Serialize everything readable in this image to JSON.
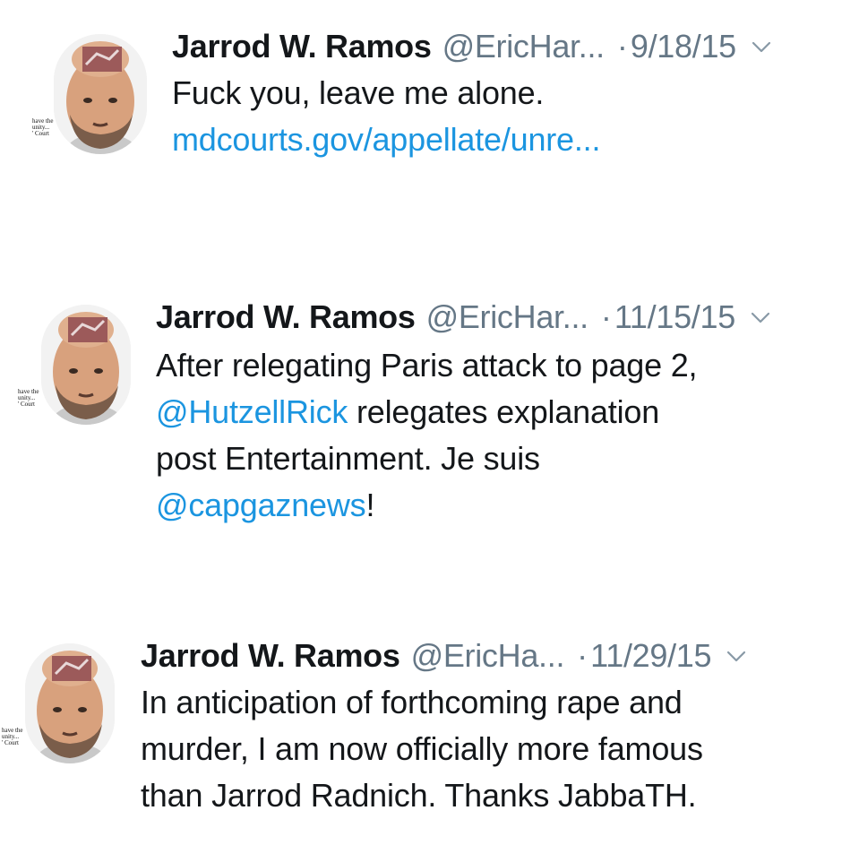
{
  "tweets": [
    {
      "name": "Jarrod W. Ramos",
      "handle": "@EricHar...",
      "dot": "·",
      "date": "9/18/15",
      "avatar_caption": "have the\nunity...\n' Court",
      "lines": [
        [
          {
            "text": "Fuck you, leave me alone.",
            "type": "text"
          }
        ],
        [
          {
            "text": "mdcourts.gov/appellate/unre...",
            "type": "link"
          }
        ]
      ]
    },
    {
      "name": "Jarrod W. Ramos",
      "handle": "@EricHar...",
      "dot": "·",
      "date": "11/15/15",
      "avatar_caption": "have the\nunity...\n' Court",
      "lines": [
        [
          {
            "text": "After relegating Paris attack to page 2,",
            "type": "text"
          }
        ],
        [
          {
            "text": "@HutzellRick",
            "type": "mention"
          },
          {
            "text": " relegates explanation",
            "type": "text"
          }
        ],
        [
          {
            "text": "post Entertainment. Je suis",
            "type": "text"
          }
        ],
        [
          {
            "text": "@capgaznews",
            "type": "mention"
          },
          {
            "text": "!",
            "type": "text"
          }
        ]
      ]
    },
    {
      "name": "Jarrod W. Ramos",
      "handle": "@EricHa...",
      "dot": "·",
      "date": "11/29/15",
      "avatar_caption": "have the\nunity...\n' Court",
      "lines": [
        [
          {
            "text": "In anticipation of forthcoming rape and",
            "type": "text"
          }
        ],
        [
          {
            "text": "murder, I am now officially more famous",
            "type": "text"
          }
        ],
        [
          {
            "text": "than Jarrod Radnich. Thanks JabbaTH.",
            "type": "text"
          }
        ]
      ]
    }
  ],
  "colors": {
    "link": "#1b95e0",
    "meta": "#657786",
    "text": "#14171a"
  },
  "icons": {
    "more": "chevron-down-icon",
    "avatar": "profile-photo"
  }
}
